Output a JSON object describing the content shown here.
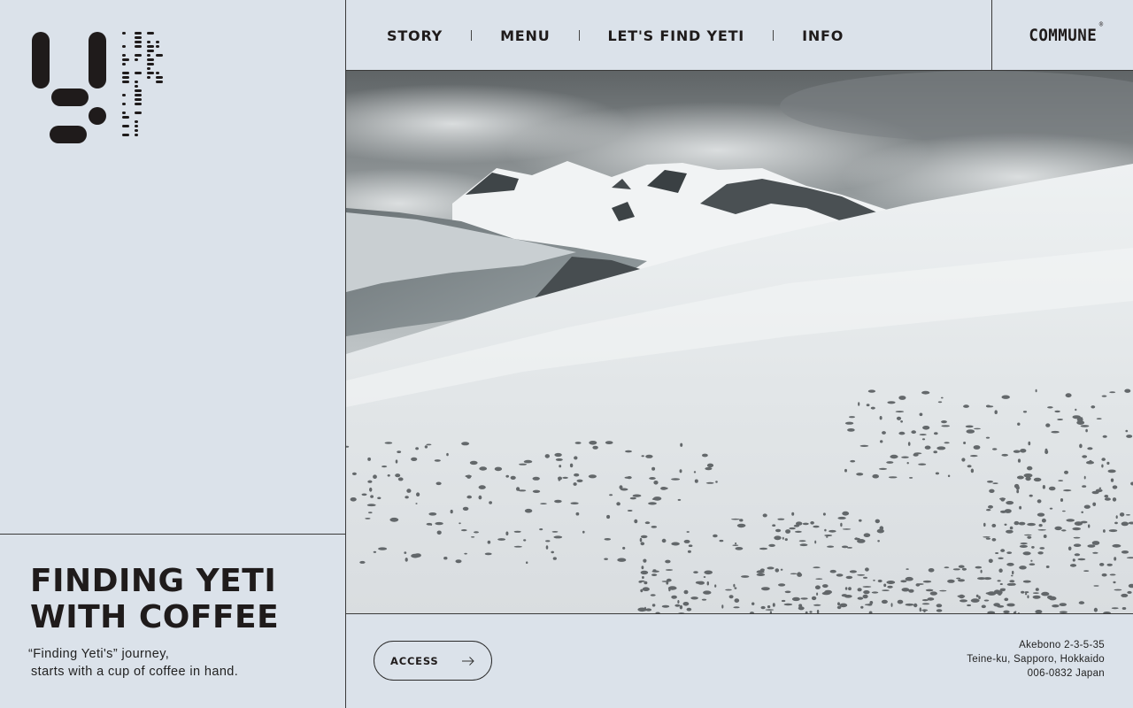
{
  "logo": {
    "mark_icon": "yeti-y-logo-icon",
    "wordmark": "finding yeti"
  },
  "nav": {
    "items": [
      "STORY",
      "MENU",
      "LET'S FIND YETI",
      "INFO"
    ]
  },
  "brand": {
    "name": "COMMUNE",
    "mark": "®"
  },
  "hero": {
    "headline_line1": "FINDING YETI",
    "headline_line2": "WITH COFFEE",
    "tagline_line1": "“Finding Yeti's” journey,",
    "tagline_line2": "starts with a cup of coffee in hand."
  },
  "media": {
    "image_alt": "snowy-mountain-landscape"
  },
  "access": {
    "label": "ACCESS",
    "icon": "arrow-right-icon"
  },
  "address": {
    "line1": "Akebono 2-3-5-35",
    "line2": "Teine-ku, Sapporo, Hokkaido",
    "line3": "006-0832 Japan"
  },
  "colors": {
    "background": "#dbe2ea",
    "ink": "#1f1b1b",
    "rule": "#3a3a3a"
  }
}
